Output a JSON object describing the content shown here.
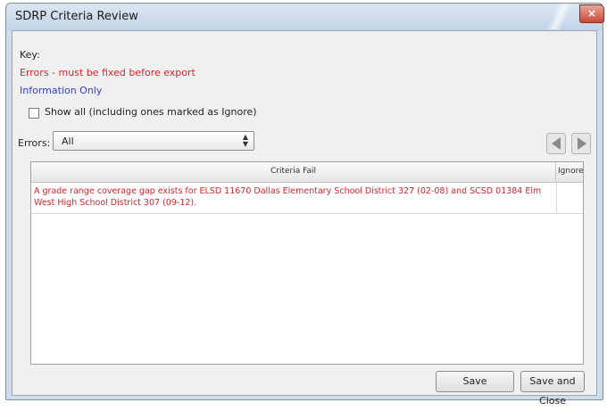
{
  "window": {
    "title": "SDRP Criteria Review",
    "close_glyph": "×"
  },
  "key": {
    "label": "Key:",
    "errors_text": "Errors - must be fixed before export",
    "info_text": "Information Only",
    "errors_color": "#d8242c",
    "info_color": "#2f3fcf"
  },
  "show_all": {
    "label": "Show all (including ones marked as Ignore)",
    "checked": false
  },
  "filter": {
    "label": "Errors:",
    "value": "All",
    "arrows": "▲▼"
  },
  "nav": {
    "prev_icon": "triangle-left",
    "next_icon": "triangle-right"
  },
  "grid": {
    "columns": [
      "Criteria Fail",
      "Ignore"
    ],
    "rows": [
      {
        "criteria": "A grade range coverage gap exists for ELSD 11670 Dallas Elementary School District 327 (02-08) and SCSD 01384 Elm West High School District 307 (09-12).",
        "ignore": ""
      }
    ]
  },
  "buttons": {
    "save": "Save",
    "save_close": "Save and Close"
  }
}
